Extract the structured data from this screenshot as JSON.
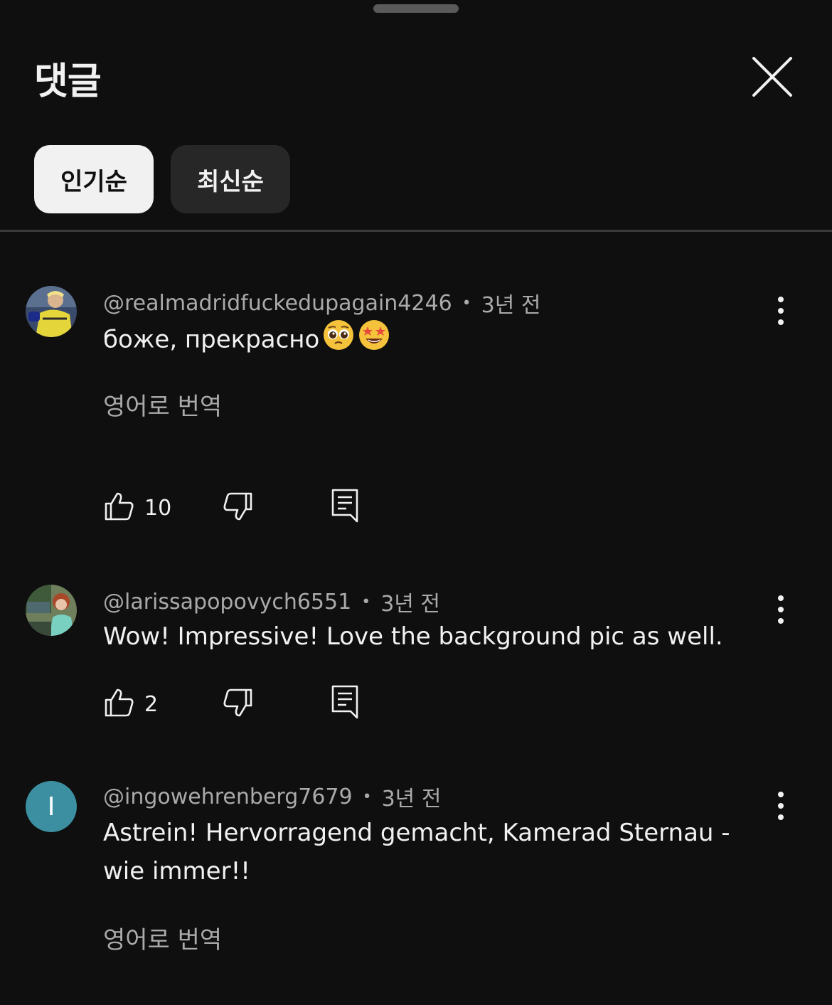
{
  "header": {
    "title": "댓글"
  },
  "sort_chips": [
    {
      "label": "인기순",
      "selected": true
    },
    {
      "label": "최신순",
      "selected": false
    }
  ],
  "comments": [
    {
      "author": "@realmadridfuckedupagain4246",
      "time": "3년 전",
      "text": "боже, прекрасно",
      "emojis": [
        "pleading-face",
        "star-struck"
      ],
      "translate_label": "영어로 번역",
      "likes": "10"
    },
    {
      "author": "@larissapopovych6551",
      "time": "3년 전",
      "text": "Wow! Impressive! Love the background pic as well.",
      "likes": "2"
    },
    {
      "author": "@ingowehrenberg7679",
      "time": "3년 전",
      "avatar_letter": "I",
      "avatar_color": "#3b8fa0",
      "text": "Astrein! Hervorragend gemacht, Kamerad Sternau - wie immer!!",
      "translate_label": "영어로 번역"
    }
  ],
  "separator": "•",
  "colors": {
    "background": "#0f0f0f",
    "chip_active_bg": "#f1f1f1",
    "chip_inactive_bg": "#272727",
    "secondary_text": "#aaaaaa"
  }
}
